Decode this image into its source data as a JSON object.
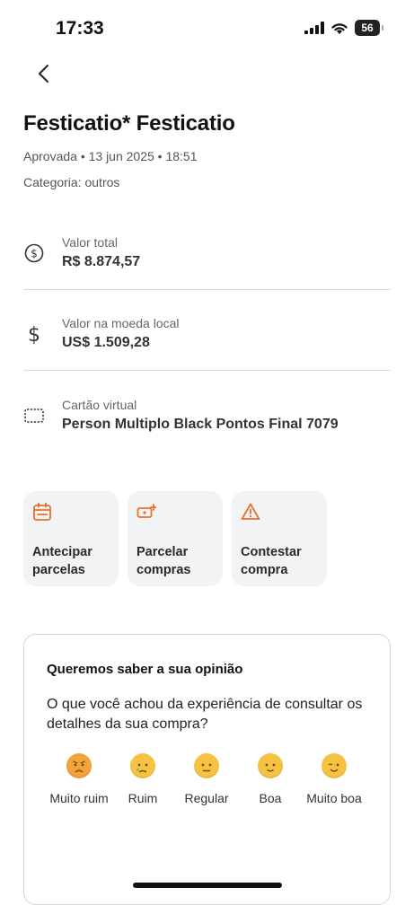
{
  "status_bar": {
    "time": "17:33",
    "battery": "56"
  },
  "header": {
    "back_icon": "chevron-left-icon"
  },
  "transaction": {
    "title": "Festicatio* Festicatio",
    "meta": "Aprovada • 13 jun 2025 • 18:51",
    "category": "Categoria: outros"
  },
  "details": [
    {
      "icon": "dollar-circle-icon",
      "label": "Valor total",
      "value": "R$ 8.874,57"
    },
    {
      "icon": "dollar-sign-icon",
      "label": "Valor na moeda local",
      "value": "US$ 1.509,28"
    },
    {
      "icon": "card-icon",
      "label": "Cartão virtual",
      "value": "Person Multiplo Black Pontos Final 7079"
    }
  ],
  "actions": [
    {
      "icon": "calendar-icon",
      "label": "Antecipar parcelas"
    },
    {
      "icon": "installment-icon",
      "label": "Parcelar compras"
    },
    {
      "icon": "warning-icon",
      "label": "Contestar compra"
    }
  ],
  "survey": {
    "title": "Queremos saber a sua opinião",
    "question": "O que você achou da experiência de consultar os detalhes da sua compra?",
    "ratings": [
      {
        "label": "Muito ruim",
        "icon": "angry-face-icon"
      },
      {
        "label": "Ruim",
        "icon": "sad-face-icon"
      },
      {
        "label": "Regular",
        "icon": "neutral-face-icon"
      },
      {
        "label": "Boa",
        "icon": "smile-face-icon"
      },
      {
        "label": "Muito boa",
        "icon": "wink-face-icon"
      }
    ]
  },
  "colors": {
    "accent": "#e8702a",
    "card_bg": "#f2f3f5",
    "emoji": "#f5c242"
  }
}
